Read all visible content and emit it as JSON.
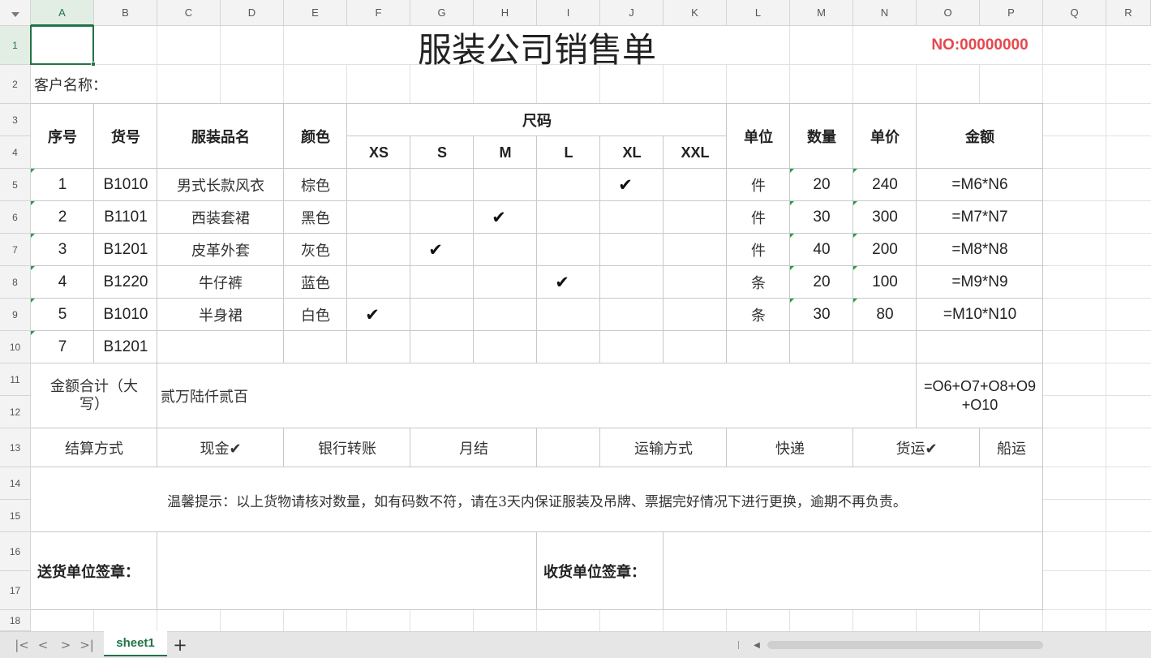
{
  "columns": [
    "A",
    "B",
    "C",
    "D",
    "E",
    "F",
    "G",
    "H",
    "I",
    "J",
    "K",
    "L",
    "M",
    "N",
    "O",
    "P",
    "Q",
    "R"
  ],
  "rows": [
    "1",
    "2",
    "3",
    "4",
    "5",
    "6",
    "7",
    "8",
    "9",
    "10",
    "11",
    "12",
    "13",
    "14",
    "15",
    "16",
    "17",
    "18"
  ],
  "selected_cell": "A1",
  "form": {
    "title": "服装公司销售单",
    "doc_no": "NO:00000000",
    "customer_label": "客户名称：",
    "headers": {
      "seq": "序号",
      "item_no": "货号",
      "name": "服装品名",
      "color": "颜色",
      "size": "尺码",
      "unit": "单位",
      "qty": "数量",
      "price": "单价",
      "amount": "金额"
    },
    "sizes": [
      "XS",
      "S",
      "M",
      "L",
      "XL",
      "XXL"
    ],
    "items": [
      {
        "seq": "1",
        "code": "B1010",
        "name": "男式长款风衣",
        "color": "棕色",
        "unit": "件",
        "qty": "20",
        "price": "240",
        "amount": "=M6*N6"
      },
      {
        "seq": "2",
        "code": "B1101",
        "name": "西装套裙",
        "color": "黑色",
        "unit": "件",
        "qty": "30",
        "price": "300",
        "amount": "=M7*N7"
      },
      {
        "seq": "3",
        "code": "B1201",
        "name": "皮革外套",
        "color": "灰色",
        "unit": "件",
        "qty": "40",
        "price": "200",
        "amount": "=M8*N8"
      },
      {
        "seq": "4",
        "code": "B1220",
        "name": "牛仔裤",
        "color": "蓝色",
        "unit": "条",
        "qty": "20",
        "price": "100",
        "amount": "=M9*N9"
      },
      {
        "seq": "5",
        "code": "B1010",
        "name": "半身裙",
        "color": "白色",
        "unit": "条",
        "qty": "30",
        "price": "80",
        "amount": "=M10*N10"
      },
      {
        "seq": "7",
        "code": "B1201",
        "name": "",
        "color": "",
        "unit": "",
        "qty": "",
        "price": "",
        "amount": ""
      }
    ],
    "check_mark": "✔",
    "total_label": "金额合计（大写）",
    "total_words": "贰万陆仟贰百",
    "total_formula_line1": "=O6+O7+O8+O9",
    "total_formula_line2": "+O10",
    "payment": {
      "label": "结算方式",
      "cash": "现金✔",
      "bank": "银行转账",
      "monthly": "月结"
    },
    "shipping": {
      "label": "运输方式",
      "express": "快递",
      "freight": "货运✔",
      "ship": "船运"
    },
    "notice": "温馨提示：以上货物请核对数量，如有码数不符，请在3天内保证服装及吊牌、票据完好情况下进行更换，逾期不再负责。",
    "sender_sign": "送货单位签章：",
    "receiver_sign": "收货单位签章："
  },
  "sheet_tab": "sheet1",
  "tab_bar": {
    "first": "|<",
    "prev": "<",
    "next": ">",
    "last": ">|",
    "add": "+",
    "scroll_left": "◀"
  }
}
